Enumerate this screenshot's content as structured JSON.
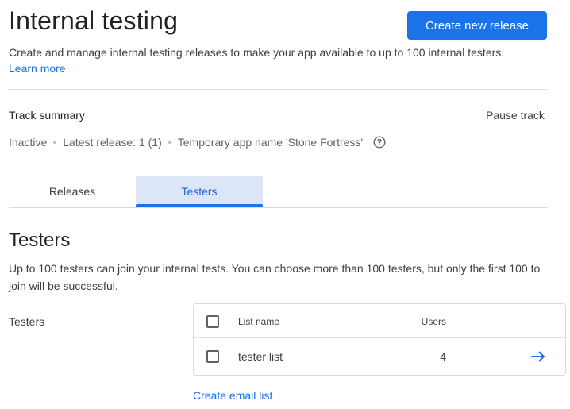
{
  "header": {
    "title": "Internal testing",
    "create_button": "Create new release",
    "description": "Create and manage internal testing releases to make your app available to up to 100 internal testers.",
    "learn_more": "Learn more"
  },
  "track": {
    "summary_label": "Track summary",
    "pause_label": "Pause track",
    "status": "Inactive",
    "latest_release": "Latest release: 1 (1)",
    "app_name": "Temporary app name 'Stone Fortress'",
    "help_icon": "help-circle-icon"
  },
  "tabs": [
    {
      "label": "Releases",
      "active": false
    },
    {
      "label": "Testers",
      "active": true
    }
  ],
  "testers": {
    "title": "Testers",
    "description": "Up to 100 testers can join your internal tests. You can choose more than 100 testers, but only the first 100 to join will be successful.",
    "field_label": "Testers",
    "table": {
      "headers": {
        "name": "List name",
        "users": "Users"
      },
      "rows": [
        {
          "name": "tester list",
          "users": "4",
          "checked": false
        }
      ],
      "row_icon": "arrow-right-icon"
    },
    "create_email_list": "Create email list"
  },
  "colors": {
    "accent": "#1a73e8",
    "active_tab_bg": "#dce6f8",
    "divider": "#dadce0"
  }
}
